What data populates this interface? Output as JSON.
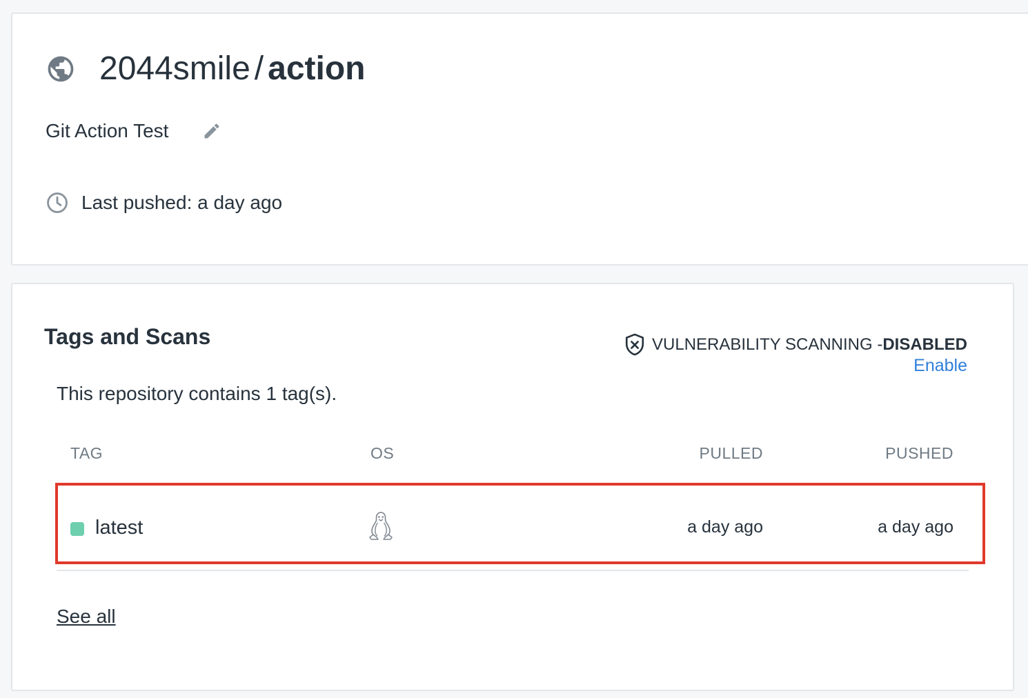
{
  "repo": {
    "namespace": "2044smile",
    "separator": "/",
    "name": "action",
    "description": "Git Action Test",
    "last_pushed": "Last pushed: a day ago",
    "visibility_icon": "globe-icon"
  },
  "tags_section": {
    "title": "Tags and Scans",
    "scan_label": "VULNERABILITY SCANNING - ",
    "scan_state": "DISABLED",
    "enable_label": "Enable",
    "tag_count_text": "This repository contains 1 tag(s).",
    "columns": {
      "tag": "TAG",
      "os": "OS",
      "pulled": "PULLED",
      "pushed": "PUSHED"
    },
    "rows": [
      {
        "tag": "latest",
        "os_icon": "linux-icon",
        "pulled": "a day ago",
        "pushed": "a day ago",
        "status_color": "#6dcfae"
      }
    ],
    "see_all_label": "See all"
  },
  "colors": {
    "accent_link": "#2f7fdb",
    "highlight": "#e0392b",
    "text": "#27323c",
    "muted": "#6f7a84"
  }
}
